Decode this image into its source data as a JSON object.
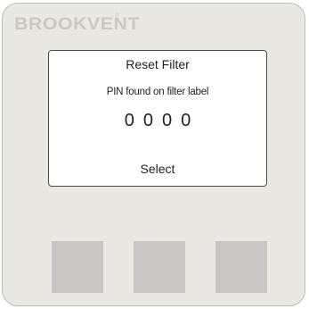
{
  "device": {
    "brand": "BROOKVENT",
    "brand_mark": "®"
  },
  "screen": {
    "title": "Reset Filter",
    "subtitle": "PIN found on filter label",
    "pin_digits": [
      "0",
      "0",
      "0",
      "0"
    ],
    "action_label": "Select"
  },
  "buttons": [
    {
      "label": ""
    },
    {
      "label": ""
    },
    {
      "label": ""
    }
  ],
  "colors": {
    "panel": "#e9e8e2",
    "brand_text": "#c9c8c3",
    "screen_bg": "#ffffff",
    "button": "#c8c7c6"
  }
}
